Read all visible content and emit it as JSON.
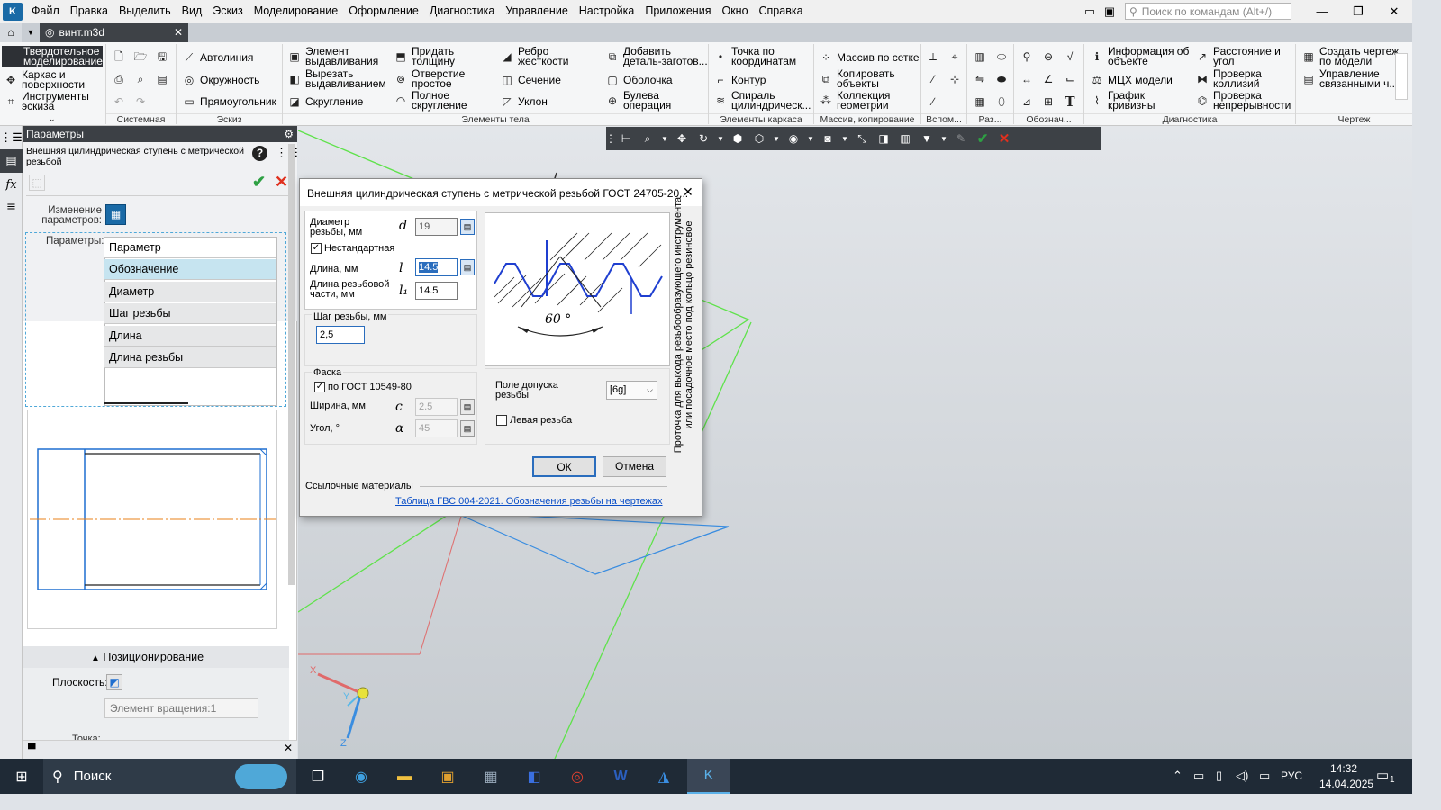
{
  "menubar": {
    "logo": "K",
    "items": [
      "Файл",
      "Правка",
      "Выделить",
      "Вид",
      "Эскиз",
      "Моделирование",
      "Оформление",
      "Диагностика",
      "Управление",
      "Настройка",
      "Приложения",
      "Окно",
      "Справка"
    ],
    "search_placeholder": "Поиск по командам (Alt+/)"
  },
  "tabs": {
    "home": "⌂",
    "document": "винт.m3d"
  },
  "ribbon": {
    "mode": "Твердотельное моделирование",
    "side_items": [
      "Каркас и поверхности",
      "Инструменты эскиза"
    ],
    "sketch": [
      "Автолиния",
      "Окружность",
      "Прямоугольник"
    ],
    "body1": [
      "Элемент выдавливания",
      "Вырезать выдавливанием",
      "Скругление"
    ],
    "body2": [
      "Придать толщину",
      "Отверстие простое",
      "Полное скругление"
    ],
    "body3": [
      "Ребро жесткости",
      "Сечение",
      "Уклон"
    ],
    "body4": [
      "Добавить деталь-заготов...",
      "Оболочка",
      "Булева операция"
    ],
    "frame": [
      "Точка по координатам",
      "Контур",
      "Спираль цилиндрическ..."
    ],
    "array": [
      "Массив по сетке",
      "Копировать объекты",
      "Коллекция геометрии"
    ],
    "diag1": [
      "Информация об объекте",
      "МЦХ модели",
      "График кривизны"
    ],
    "diag2": [
      "Расстояние и угол",
      "Проверка коллизий",
      "Проверка непрерывности"
    ],
    "drawing": [
      "Создать чертеж по модели",
      "Управление связанными ч..."
    ],
    "sections": [
      "Системная",
      "Эскиз",
      "Элементы тела",
      "Элементы каркаса",
      "Массив, копирование",
      "Вспом...",
      "Раз...",
      "Обознач...",
      "Диагностика",
      "Чертеж"
    ]
  },
  "panel": {
    "title": "Параметры",
    "operation": "Внешняя цилиндрическая ступень с метрической резьбой",
    "change_params_label": "Изменение параметров:",
    "params_label": "Параметры:",
    "params_list": [
      "Параметр",
      "Обозначение",
      "Диаметр",
      "Шаг резьбы",
      "Длина",
      "Длина резьбы"
    ],
    "positioning": "Позиционирование",
    "plane_label": "Плоскость:",
    "plane_value": "Элемент вращения:1",
    "points_label": "Точка:"
  },
  "dialog": {
    "title": "Внешняя цилиндрическая ступень с метрической резьбой ГОСТ 24705-20...",
    "diameter_label": "Диаметр резьбы, мм",
    "diameter_symbol": "d",
    "diameter_value": "19",
    "nonstandard_label": "Нестандартная",
    "length_label": "Длина, мм",
    "length_symbol": "l",
    "length_value": "14.5",
    "thread_length_label": "Длина резьбовой части, мм",
    "thread_length_symbol": "l₁",
    "thread_length_value": "14.5",
    "pitch_label": "Шаг резьбы, мм",
    "pitch_value": "2,5",
    "chamfer_label": "Фаска",
    "chamfer_gost_label": "по ГОСТ 10549-80",
    "width_label": "Ширина, мм",
    "width_symbol": "c",
    "width_value": "2.5",
    "angle_label": "Угол, °",
    "angle_symbol": "α",
    "angle_value": "45",
    "angle_diagram": "60 °",
    "tolerance_label": "Поле допуска резьбы",
    "tolerance_value": "[6g]",
    "left_thread_label": "Левая резьба",
    "side_text_1": "Проточка для выхода резьбообразующего инструмента",
    "side_text_2": "или посадочное место под кольцо резиновое",
    "ok": "ОК",
    "cancel": "Отмена",
    "refs_label": "Ссылочные материалы",
    "refs_link": "Таблица ГВС 004-2021. Обозначения резьбы на чертежах"
  },
  "axes": {
    "x": "X",
    "y": "Y",
    "z": "Z"
  },
  "taskbar": {
    "search": "Поиск",
    "lang": "РУС",
    "time": "14:32",
    "date": "14.04.2025",
    "notif_count": "1"
  },
  "colors": {
    "accent": "#1a6aa6",
    "green_check": "#2ea043",
    "red_x": "#e0301e",
    "link": "#0b4fc7"
  }
}
